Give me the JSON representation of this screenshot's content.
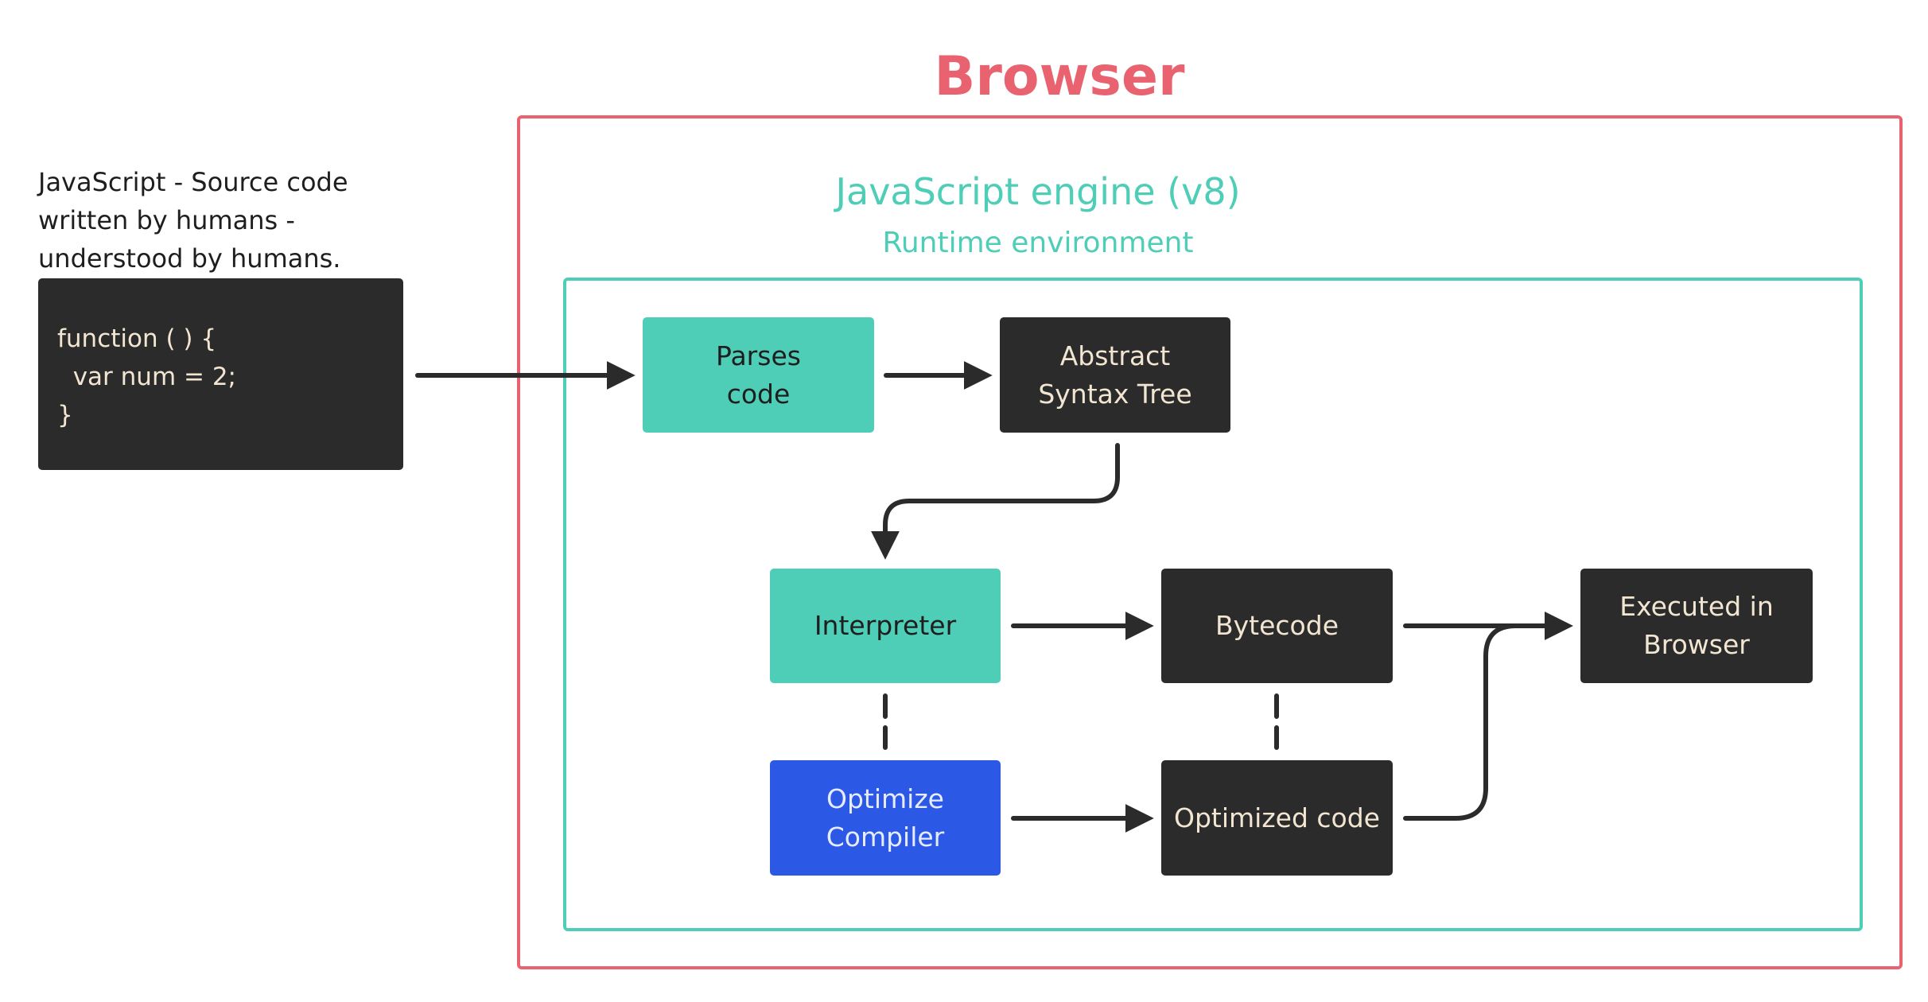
{
  "colors": {
    "browser_red": "#e8636f",
    "engine_teal": "#4ecdb7",
    "dark_box": "#2b2b2b",
    "compiler_blue": "#2b59e6",
    "dark_text": "#f2e6d2",
    "teal_text": "#1e1e1e",
    "blue_text": "#e6ebff",
    "arrow": "#2b2b2b"
  },
  "browser": {
    "title": "Browser"
  },
  "engine": {
    "title": "JavaScript engine (v8)",
    "subtitle": "Runtime environment"
  },
  "source": {
    "caption_lines": [
      "JavaScript - Source code",
      "written by humans -",
      "understood by humans."
    ],
    "code_lines": [
      "function ( ) {",
      "  var num = 2;",
      "}"
    ]
  },
  "nodes": {
    "parses": "Parses\ncode",
    "ast": "Abstract\nSyntax Tree",
    "interpreter": "Interpreter",
    "bytecode": "Bytecode",
    "executed": "Executed in\nBrowser",
    "compiler": "Optimize\nCompiler",
    "optimized": "Optimized code"
  }
}
